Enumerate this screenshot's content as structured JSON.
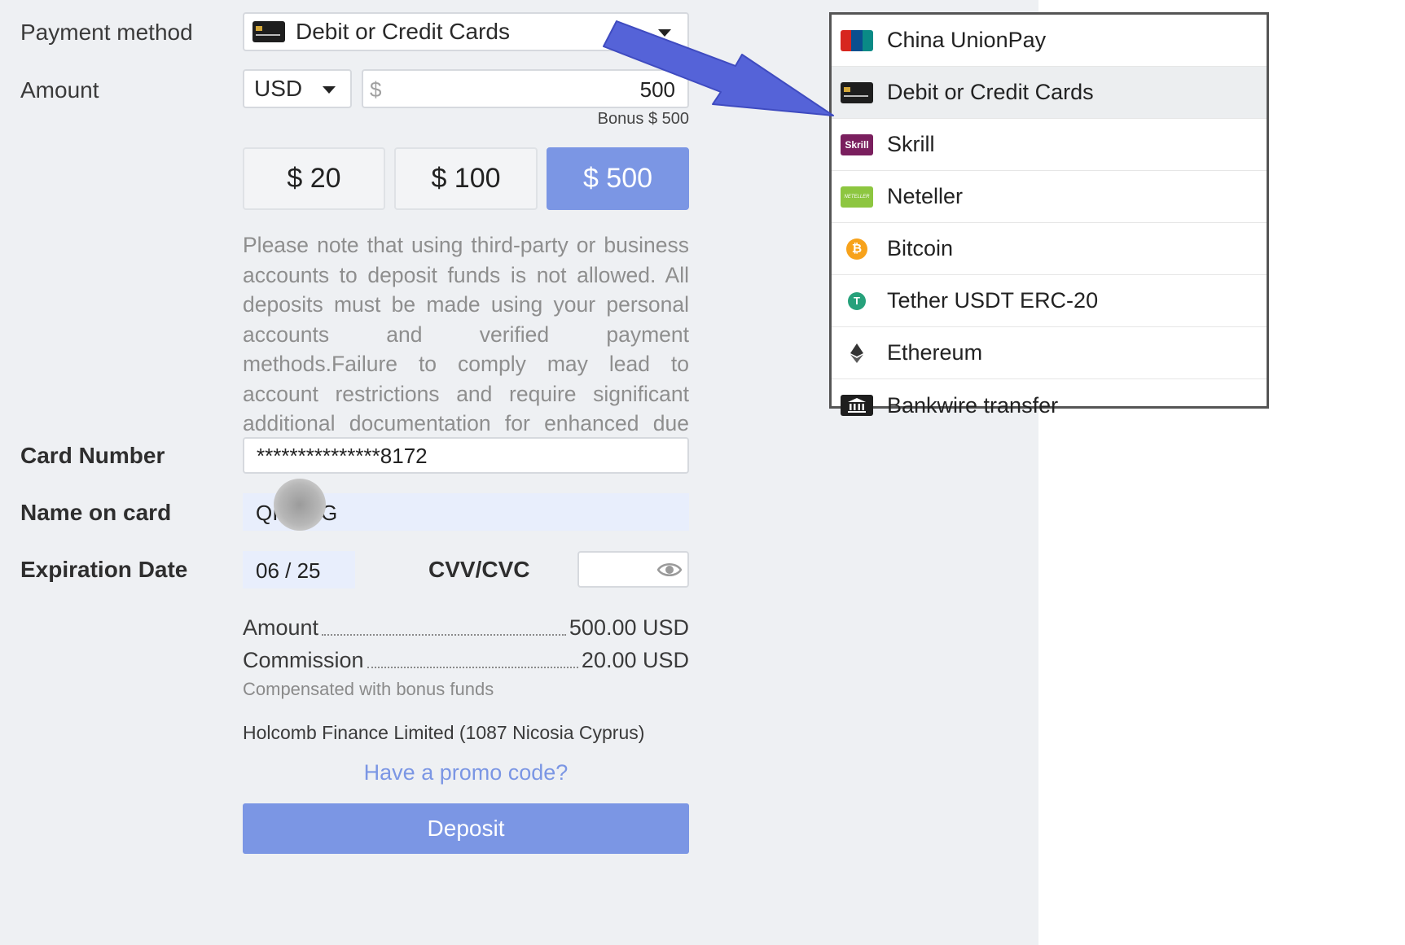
{
  "payment_method": {
    "label": "Payment method",
    "selected": "Debit or Credit Cards"
  },
  "amount": {
    "label": "Amount",
    "currency": "USD",
    "currency_symbol": "$",
    "value": "500",
    "bonus": "Bonus $ 500",
    "presets": [
      "$ 20",
      "$ 100",
      "$ 500"
    ],
    "active_preset_index": 2
  },
  "note": "Please note that using third-party or business accounts to deposit funds is not allowed. All deposits must be made using your personal accounts and verified payment methods.Failure to comply may lead to account restrictions and require significant additional documentation for enhanced due diligence.",
  "card": {
    "number_label": "Card Number",
    "number_value": "***************8172",
    "name_label": "Name on card",
    "name_value_start": "QI",
    "name_value_end": "G",
    "expiry_label": "Expiration Date",
    "expiry_value": "06 / 25",
    "cvv_label": "CVV/CVC"
  },
  "summary": {
    "amount_label": "Amount",
    "amount_value": "500.00 USD",
    "commission_label": "Commission",
    "commission_value": "20.00 USD",
    "compensated_note": "Compensated with bonus funds",
    "company": "Holcomb Finance Limited (1087 Nicosia Cyprus)",
    "promo": "Have a promo code?",
    "deposit_button": "Deposit"
  },
  "dropdown": {
    "items": [
      {
        "label": "China UnionPay",
        "icon": "unionpay-icon",
        "icon_text": "UnionPay"
      },
      {
        "label": "Debit or Credit Cards",
        "icon": "credit-card-icon"
      },
      {
        "label": "Skrill",
        "icon": "skrill-icon",
        "icon_text": "Skrill"
      },
      {
        "label": "Neteller",
        "icon": "neteller-icon",
        "icon_text": "NETELLER"
      },
      {
        "label": "Bitcoin",
        "icon": "bitcoin-icon",
        "icon_text": "₿"
      },
      {
        "label": "Tether USDT ERC-20",
        "icon": "tether-icon",
        "icon_text": "T"
      },
      {
        "label": "Ethereum",
        "icon": "ethereum-icon"
      },
      {
        "label": "Bankwire transfer",
        "icon": "bank-icon"
      }
    ],
    "selected_index": 1
  },
  "colors": {
    "accent": "#7b96e4",
    "arrow": "#5563d8",
    "left_background": "#eef0f3"
  }
}
